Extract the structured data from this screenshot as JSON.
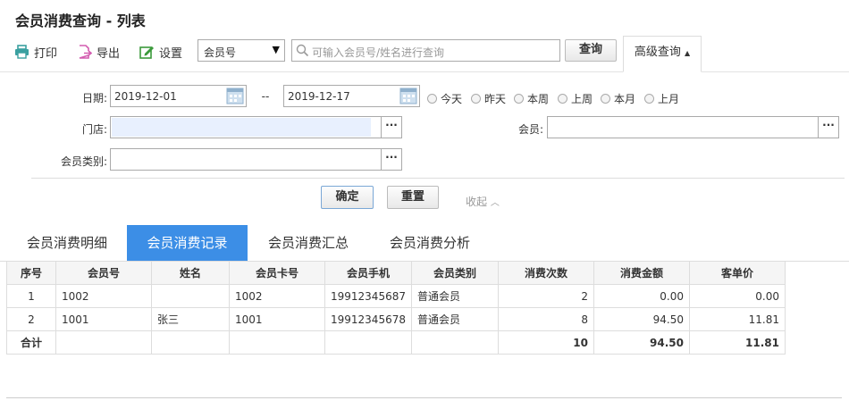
{
  "title": "会员消费查询 - 列表",
  "toolbar": {
    "print": "打印",
    "export": "导出",
    "settings": "设置",
    "field_select": "会员号",
    "search_placeholder": "可输入会员号/姓名进行查询",
    "query": "查询",
    "advanced": "高级查询"
  },
  "filters": {
    "date_label": "日期:",
    "date_from": "2019-12-01",
    "date_sep": "--",
    "date_to": "2019-12-17",
    "ranges": [
      "今天",
      "昨天",
      "本周",
      "上周",
      "本月",
      "上月"
    ],
    "store_label": "门店:",
    "store_value": "",
    "member_label": "会员:",
    "member_value": "",
    "member_type_label": "会员类别:",
    "member_type_value": "",
    "confirm": "确定",
    "reset": "重置",
    "collapse": "收起"
  },
  "tabs": [
    "会员消费明细",
    "会员消费记录",
    "会员消费汇总",
    "会员消费分析"
  ],
  "active_tab": 1,
  "table": {
    "columns": [
      "序号",
      "会员号",
      "姓名",
      "会员卡号",
      "会员手机",
      "会员类别",
      "消费次数",
      "消费金额",
      "客单价"
    ],
    "rows": [
      [
        "1",
        "1002",
        "",
        "1002",
        "19912345687",
        "普通会员",
        "2",
        "0.00",
        "0.00"
      ],
      [
        "2",
        "1001",
        "张三",
        "1001",
        "19912345678",
        "普通会员",
        "8",
        "94.50",
        "11.81"
      ]
    ],
    "total": [
      "合计",
      "",
      "",
      "",
      "",
      "",
      "10",
      "94.50",
      "11.81"
    ]
  },
  "colors": {
    "accent": "#3c8ee6",
    "print_icon": "#3aa0a0",
    "export_icon": "#d35db0",
    "settings_icon": "#3b9a3b"
  }
}
